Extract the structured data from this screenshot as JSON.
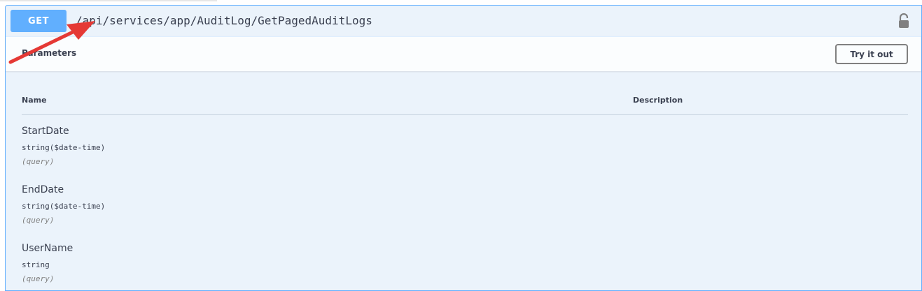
{
  "operation": {
    "method": "GET",
    "path": "/api/services/app/AuditLog/GetPagedAuditLogs",
    "lock_icon": "unlocked-padlock-icon"
  },
  "parameters_section": {
    "title": "Parameters",
    "try_it_out_label": "Try it out"
  },
  "table": {
    "columns": [
      "Name",
      "Description"
    ],
    "rows": [
      {
        "name": "StartDate",
        "type": "string($date-time)",
        "in": "(query)"
      },
      {
        "name": "EndDate",
        "type": "string($date-time)",
        "in": "(query)"
      },
      {
        "name": "UserName",
        "type": "string",
        "in": "(query)"
      }
    ]
  },
  "colors": {
    "get_accent": "#61affe",
    "block_background": "#ebf3fb",
    "text": "#3b4151",
    "annotation_arrow": "#e53935"
  }
}
